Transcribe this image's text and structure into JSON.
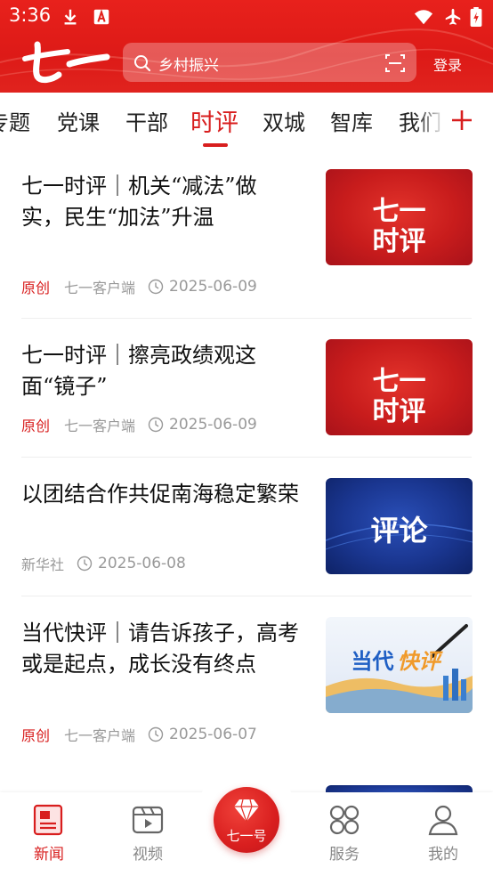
{
  "status_bar": {
    "time": "3:36"
  },
  "header": {
    "logo_text": "七一",
    "search_placeholder": "乡村振兴",
    "login_label": "登录"
  },
  "tabs": [
    {
      "label": "专题"
    },
    {
      "label": "党课"
    },
    {
      "label": "干部"
    },
    {
      "label": "时评",
      "active": true
    },
    {
      "label": "双城"
    },
    {
      "label": "智库"
    },
    {
      "label": "我们"
    }
  ],
  "articles": [
    {
      "title": "七一时评｜机关“减法”做实，民生“加法”升温",
      "tag": "原创",
      "source": "七一客户端",
      "date": "2025-06-09",
      "thumb_text": "七一\n时评",
      "thumb_line1": "七一",
      "thumb_line2": "时评"
    },
    {
      "title": "七一时评｜擦亮政绩观这面“镜子”",
      "tag": "原创",
      "source": "七一客户端",
      "date": "2025-06-09",
      "thumb_line1": "七一",
      "thumb_line2": "时评"
    },
    {
      "title": "以团结合作共促南海稳定繁荣",
      "source": "新华社",
      "date": "2025-06-08",
      "thumb_line1": "评论"
    },
    {
      "title": "当代快评｜请告诉孩子，高考或是起点，成长没有终点",
      "tag": "原创",
      "source": "七一客户端",
      "date": "2025-06-07",
      "thumb_line1": "当代",
      "thumb_line2": "快评"
    }
  ],
  "bottom_nav": {
    "items": [
      {
        "label": "新闻",
        "icon": "news-icon",
        "active": true
      },
      {
        "label": "视频",
        "icon": "video-icon"
      },
      {
        "label": "服务",
        "icon": "services-icon"
      },
      {
        "label": "我的",
        "icon": "profile-icon"
      }
    ],
    "center_label": "七一号"
  },
  "colors": {
    "brand_red": "#d81e1e",
    "header_red": "#e3221c",
    "blue_thumb": "#1a3690"
  }
}
